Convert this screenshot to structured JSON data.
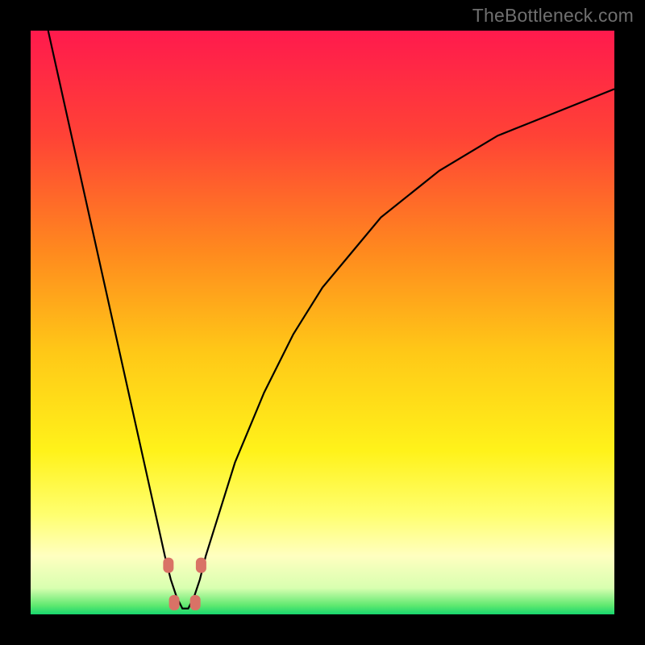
{
  "watermark": "TheBottleneck.com",
  "chart_data": {
    "type": "line",
    "title": "",
    "xlabel": "",
    "ylabel": "",
    "xlim": [
      0,
      100
    ],
    "ylim": [
      0,
      100
    ],
    "series": [
      {
        "name": "bottleneck-curve",
        "x": [
          3,
          5,
          7,
          9,
          11,
          13,
          15,
          17,
          19,
          21,
          23,
          24,
          25,
          26,
          27,
          28,
          29,
          30,
          35,
          40,
          45,
          50,
          55,
          60,
          65,
          70,
          75,
          80,
          85,
          90,
          95,
          100
        ],
        "y": [
          100,
          91,
          82,
          73,
          64,
          55,
          46,
          37,
          28,
          19,
          10,
          6,
          3,
          1,
          1,
          3,
          6,
          10,
          26,
          38,
          48,
          56,
          62,
          68,
          72,
          76,
          79,
          82,
          84,
          86,
          88,
          90
        ]
      }
    ],
    "markers": [
      {
        "x": 23.6,
        "y": 8.4
      },
      {
        "x": 29.2,
        "y": 8.4
      },
      {
        "x": 24.6,
        "y": 2.0
      },
      {
        "x": 28.2,
        "y": 2.0
      }
    ],
    "gradient_stops": [
      {
        "offset": 0.0,
        "color": "#ff1a4d"
      },
      {
        "offset": 0.18,
        "color": "#ff4236"
      },
      {
        "offset": 0.38,
        "color": "#ff8a1e"
      },
      {
        "offset": 0.55,
        "color": "#ffc817"
      },
      {
        "offset": 0.72,
        "color": "#fff21a"
      },
      {
        "offset": 0.83,
        "color": "#ffff70"
      },
      {
        "offset": 0.9,
        "color": "#ffffc0"
      },
      {
        "offset": 0.955,
        "color": "#d8ffb0"
      },
      {
        "offset": 0.985,
        "color": "#5ee86f"
      },
      {
        "offset": 1.0,
        "color": "#17d66e"
      }
    ],
    "marker_color": "#d97266",
    "curve_color": "#000000"
  }
}
